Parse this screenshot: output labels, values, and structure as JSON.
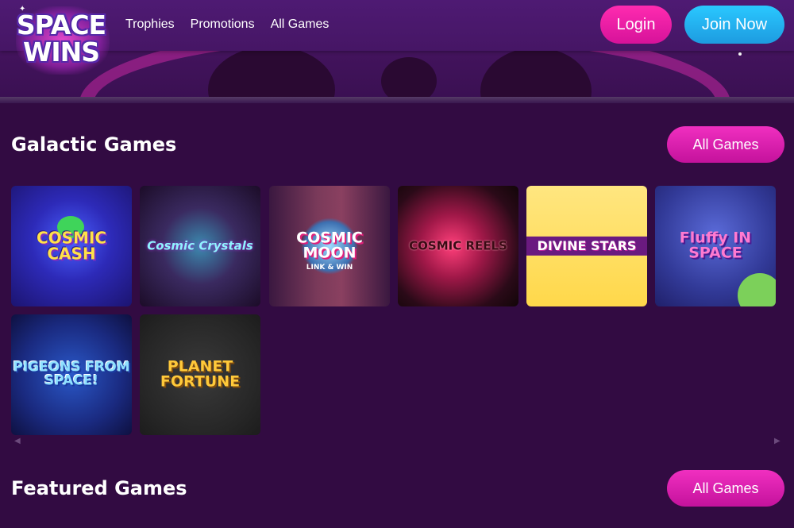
{
  "brand": {
    "logo_line1": "SPACE",
    "logo_line2": "WINS"
  },
  "nav": {
    "items": [
      "Trophies",
      "Promotions",
      "All Games"
    ]
  },
  "auth": {
    "login_label": "Login",
    "join_label": "Join Now"
  },
  "sections": [
    {
      "title": "Galactic Games",
      "all_label": "All Games",
      "games": [
        {
          "name": "COSMIC CASH"
        },
        {
          "name": "Cosmic Crystals"
        },
        {
          "name": "COSMIC MOON",
          "sub": "LINK & WIN"
        },
        {
          "name": "COSMIC REELS"
        },
        {
          "name": "DIVINE STARS"
        },
        {
          "name": "Fluffy IN SPACE"
        },
        {
          "name": "PIGEONS FROM SPACE!"
        },
        {
          "name": "PLANET FORTUNE"
        }
      ]
    },
    {
      "title": "Featured Games",
      "all_label": "All Games"
    }
  ],
  "icons": {
    "carousel_prev": "chevron-left-icon",
    "carousel_next": "chevron-right-icon"
  },
  "colors": {
    "background": "#320b42",
    "login": "#f01fa8",
    "join": "#27b5f3",
    "all_games": "#e21fb2"
  }
}
